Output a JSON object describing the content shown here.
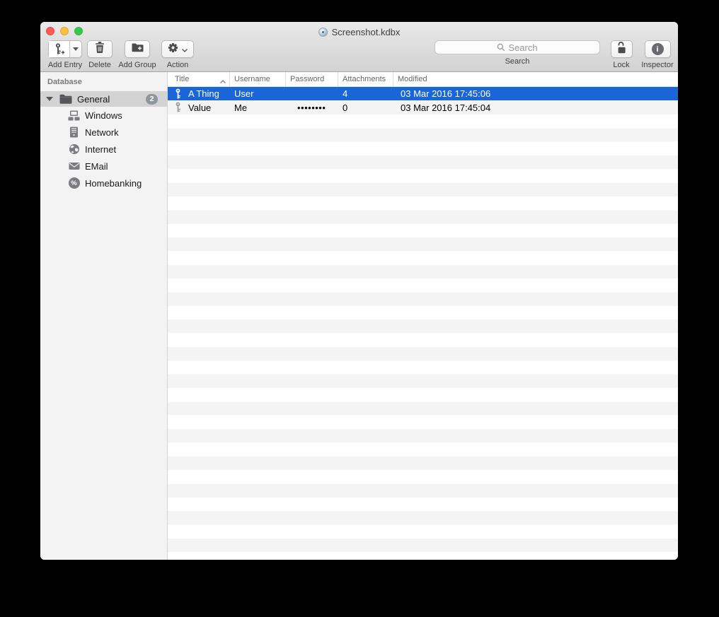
{
  "window": {
    "title": "Screenshot.kdbx"
  },
  "toolbar": {
    "add_entry_label": "Add Entry",
    "delete_label": "Delete",
    "add_group_label": "Add Group",
    "action_label": "Action",
    "search": {
      "placeholder": "Search",
      "label": "Search"
    },
    "lock_label": "Lock",
    "inspector_label": "Inspector",
    "glyphs": {
      "inspector": "i"
    }
  },
  "sidebar": {
    "header": "Database",
    "group": {
      "label": "General",
      "badge": "2",
      "selected": true,
      "icon": "folder-icon",
      "state": "expanded"
    },
    "items": [
      {
        "label": "Windows",
        "icon": "windows-icon"
      },
      {
        "label": "Network",
        "icon": "server-icon"
      },
      {
        "label": "Internet",
        "icon": "globe-icon"
      },
      {
        "label": "EMail",
        "icon": "envelope-icon"
      },
      {
        "label": "Homebanking",
        "icon": "percent-icon"
      }
    ],
    "glyphs": {
      "homebanking": "%"
    }
  },
  "table": {
    "columns": [
      {
        "label": "Title",
        "sort": "asc"
      },
      {
        "label": "Username"
      },
      {
        "label": "Password"
      },
      {
        "label": "Attachments"
      },
      {
        "label": "Modified"
      }
    ],
    "rows": [
      {
        "icon": "key-icon",
        "title": "A Thing",
        "username": "User",
        "password": "",
        "attachments": "4",
        "modified": "03 Mar 2016 17:45:06",
        "selected": true
      },
      {
        "icon": "key-icon",
        "title": "Value",
        "username": "Me",
        "password": "••••••••",
        "attachments": "0",
        "modified": "03 Mar 2016 17:45:04",
        "selected": false
      }
    ]
  },
  "colors": {
    "selection_blue": "#1a66d9",
    "row_stripe": "#f4f4f5",
    "sidebar_selection": "#d3d3d3",
    "toolbar_gradient_top": "#e9e9e9",
    "toolbar_gradient_bottom": "#d2d2d2"
  }
}
